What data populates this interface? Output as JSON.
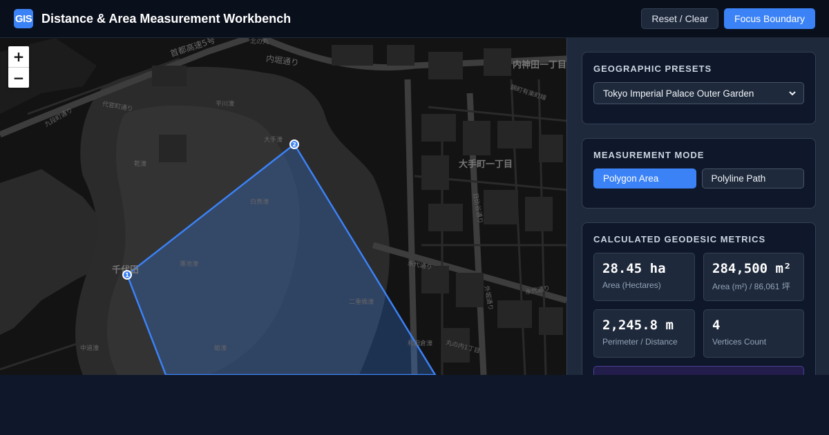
{
  "header": {
    "logo": "GIS",
    "title": "Distance & Area Measurement Workbench",
    "reset_label": "Reset / Clear",
    "focus_label": "Focus Boundary"
  },
  "map": {
    "zoom_in": "+",
    "zoom_out": "−",
    "labels": [
      "首都高速5号",
      "内堀通り",
      "内神田一丁目",
      "北の丸",
      "代官町通り",
      "九段町通り",
      "錦町有楽町線",
      "平川濠",
      "大手濠",
      "大手町一丁目",
      "乾濠",
      "白鳥濠",
      "日比谷通り",
      "千代田",
      "蓮池濠",
      "永代通り",
      "永代通り",
      "二重橋濠",
      "和田倉濠",
      "丸の内1丁目",
      "中道濠",
      "蛤濠",
      "外堀通り"
    ],
    "vertices": [
      "1",
      "2"
    ],
    "colors": {
      "polygon_fill": "#3b82f6",
      "polygon_stroke": "#3b82f6",
      "background": "#141414"
    }
  },
  "sidebar": {
    "presets": {
      "title": "GEOGRAPHIC PRESETS",
      "selected": "Tokyo Imperial Palace Outer Garden"
    },
    "mode": {
      "title": "MEASUREMENT MODE",
      "options": [
        "Polygon Area",
        "Polyline Path"
      ],
      "active": "Polygon Area"
    },
    "metrics": {
      "title": "CALCULATED GEODESIC METRICS",
      "items": [
        {
          "value": "28.45 ha",
          "label": "Area (Hectares)"
        },
        {
          "value": "284,500 m²",
          "label": "Area (m²) / 86,061 坪"
        },
        {
          "value": "2,245.8 m",
          "label": "Perimeter / Distance"
        },
        {
          "value": "4",
          "label": "Vertices Count"
        }
      ]
    }
  },
  "colors": {
    "accent": "#3b82f6",
    "panel": "#0f172a",
    "sidebar": "#1e293b"
  }
}
